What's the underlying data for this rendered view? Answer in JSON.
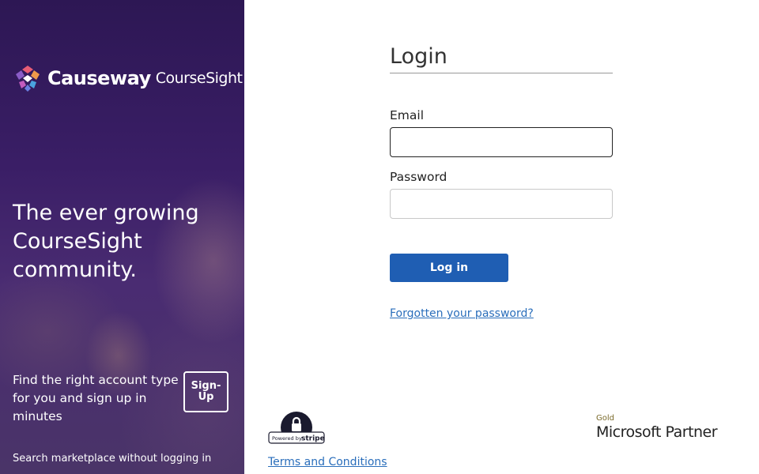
{
  "brand": {
    "name": "Causeway",
    "product": "CourseSight",
    "colors": {
      "panel": "#3a1e66",
      "primary_button": "#1f5eb3",
      "link": "#2a6ebb"
    }
  },
  "left_panel": {
    "headline": "The ever growing CourseSight community.",
    "signup_text": "Find the right account type for you and sign up in minutes",
    "signup_button": "Sign-Up",
    "marketplace_link": "Search marketplace without logging in"
  },
  "login_form": {
    "title": "Login",
    "email_label": "Email",
    "email_value": "",
    "password_label": "Password",
    "password_value": "",
    "login_button": "Log in",
    "forgot_link": "Forgotten your password?"
  },
  "footer": {
    "stripe_badge": {
      "icon": "lock-icon",
      "text_small": "Powered by",
      "text_brand": "stripe"
    },
    "terms_link": "Terms and Conditions",
    "partner": {
      "tier": "Gold",
      "name": "Microsoft Partner"
    }
  }
}
